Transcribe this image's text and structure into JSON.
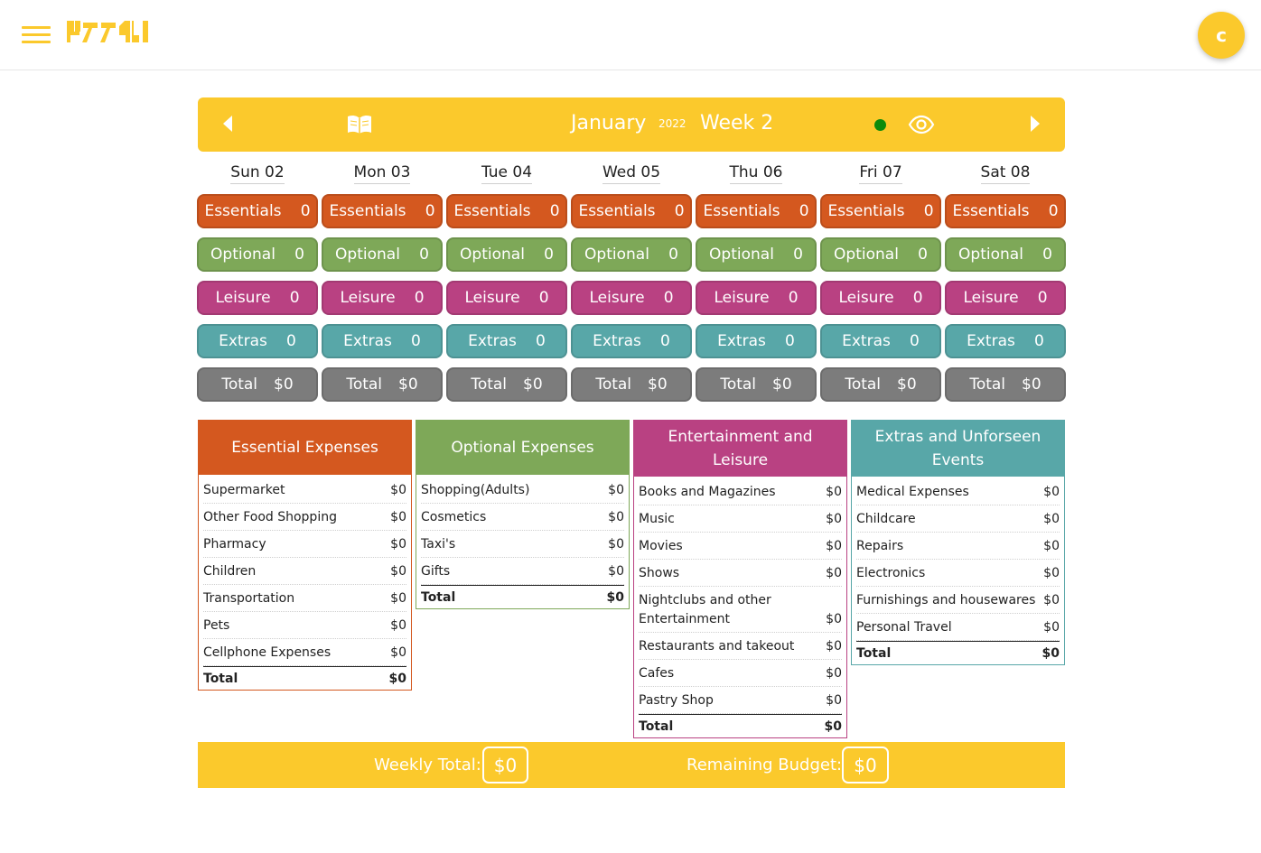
{
  "brand": {
    "logo_text": "LEVAI",
    "accent": "#fbc92c"
  },
  "user": {
    "avatar_initial": "c"
  },
  "week": {
    "month": "January",
    "year": "2022",
    "week_label": "Week 2",
    "status_color": "#0b8a0b"
  },
  "days": [
    {
      "label": "Sun 02",
      "essentials": "Essentials",
      "essentials_value": "0",
      "optional": "Optional",
      "optional_value": "0",
      "leisure": "Leisure",
      "leisure_value": "0",
      "extras": "Extras",
      "extras_value": "0",
      "total": "Total",
      "total_value": "$0"
    },
    {
      "label": "Mon 03",
      "essentials": "Essentials",
      "essentials_value": "0",
      "optional": "Optional",
      "optional_value": "0",
      "leisure": "Leisure",
      "leisure_value": "0",
      "extras": "Extras",
      "extras_value": "0",
      "total": "Total",
      "total_value": "$0"
    },
    {
      "label": "Tue 04",
      "essentials": "Essentials",
      "essentials_value": "0",
      "optional": "Optional",
      "optional_value": "0",
      "leisure": "Leisure",
      "leisure_value": "0",
      "extras": "Extras",
      "extras_value": "0",
      "total": "Total",
      "total_value": "$0"
    },
    {
      "label": "Wed 05",
      "essentials": "Essentials",
      "essentials_value": "0",
      "optional": "Optional",
      "optional_value": "0",
      "leisure": "Leisure",
      "leisure_value": "0",
      "extras": "Extras",
      "extras_value": "0",
      "total": "Total",
      "total_value": "$0"
    },
    {
      "label": "Thu 06",
      "essentials": "Essentials",
      "essentials_value": "0",
      "optional": "Optional",
      "optional_value": "0",
      "leisure": "Leisure",
      "leisure_value": "0",
      "extras": "Extras",
      "extras_value": "0",
      "total": "Total",
      "total_value": "$0"
    },
    {
      "label": "Fri 07",
      "essentials": "Essentials",
      "essentials_value": "0",
      "optional": "Optional",
      "optional_value": "0",
      "leisure": "Leisure",
      "leisure_value": "0",
      "extras": "Extras",
      "extras_value": "0",
      "total": "Total",
      "total_value": "$0"
    },
    {
      "label": "Sat 08",
      "essentials": "Essentials",
      "essentials_value": "0",
      "optional": "Optional",
      "optional_value": "0",
      "leisure": "Leisure",
      "leisure_value": "0",
      "extras": "Extras",
      "extras_value": "0",
      "total": "Total",
      "total_value": "$0"
    }
  ],
  "colors": {
    "essentials": "#d4581f",
    "optional": "#7ea858",
    "leisure": "#b94182",
    "extras": "#58a7a8",
    "total": "#7c7c7c"
  },
  "categories": [
    {
      "title": "Essential Expenses",
      "items": [
        {
          "name": "Supermarket",
          "amount": "$0"
        },
        {
          "name": "Other Food Shopping",
          "amount": "$0"
        },
        {
          "name": "Pharmacy",
          "amount": "$0"
        },
        {
          "name": "Children",
          "amount": "$0"
        },
        {
          "name": "Transportation",
          "amount": "$0"
        },
        {
          "name": "Pets",
          "amount": "$0"
        },
        {
          "name": "Cellphone Expenses",
          "amount": "$0"
        }
      ],
      "total_label": "Total",
      "total_amount": "$0"
    },
    {
      "title": "Optional Expenses",
      "items": [
        {
          "name": "Shopping(Adults)",
          "amount": "$0"
        },
        {
          "name": "Cosmetics",
          "amount": "$0"
        },
        {
          "name": "Taxi's",
          "amount": "$0"
        },
        {
          "name": "Gifts",
          "amount": "$0"
        }
      ],
      "total_label": "Total",
      "total_amount": "$0"
    },
    {
      "title": "Entertainment and Leisure",
      "items": [
        {
          "name": "Books and Magazines",
          "amount": "$0"
        },
        {
          "name": "Music",
          "amount": "$0"
        },
        {
          "name": "Movies",
          "amount": "$0"
        },
        {
          "name": "Shows",
          "amount": "$0"
        },
        {
          "name": "Nightclubs and other Entertainment",
          "amount": "$0"
        },
        {
          "name": "Restaurants and takeout",
          "amount": "$0"
        },
        {
          "name": "Cafes",
          "amount": "$0"
        },
        {
          "name": "Pastry Shop",
          "amount": "$0"
        }
      ],
      "total_label": "Total",
      "total_amount": "$0"
    },
    {
      "title": "Extras and Unforseen Events",
      "items": [
        {
          "name": "Medical Expenses",
          "amount": "$0"
        },
        {
          "name": "Childcare",
          "amount": "$0"
        },
        {
          "name": "Repairs",
          "amount": "$0"
        },
        {
          "name": "Electronics",
          "amount": "$0"
        },
        {
          "name": "Furnishings and housewares",
          "amount": "$0"
        },
        {
          "name": "Personal Travel",
          "amount": "$0"
        }
      ],
      "total_label": "Total",
      "total_amount": "$0"
    }
  ],
  "footer": {
    "weekly_total_label": "Weekly Total:",
    "weekly_total_value": "$0",
    "remaining_label": "Remaining Budget:",
    "remaining_value": "$0"
  },
  "icons": {
    "menu": "hamburger-icon",
    "prev": "arrow-left-icon",
    "next": "arrow-right-icon",
    "book": "book-icon",
    "eye": "eye-icon"
  }
}
